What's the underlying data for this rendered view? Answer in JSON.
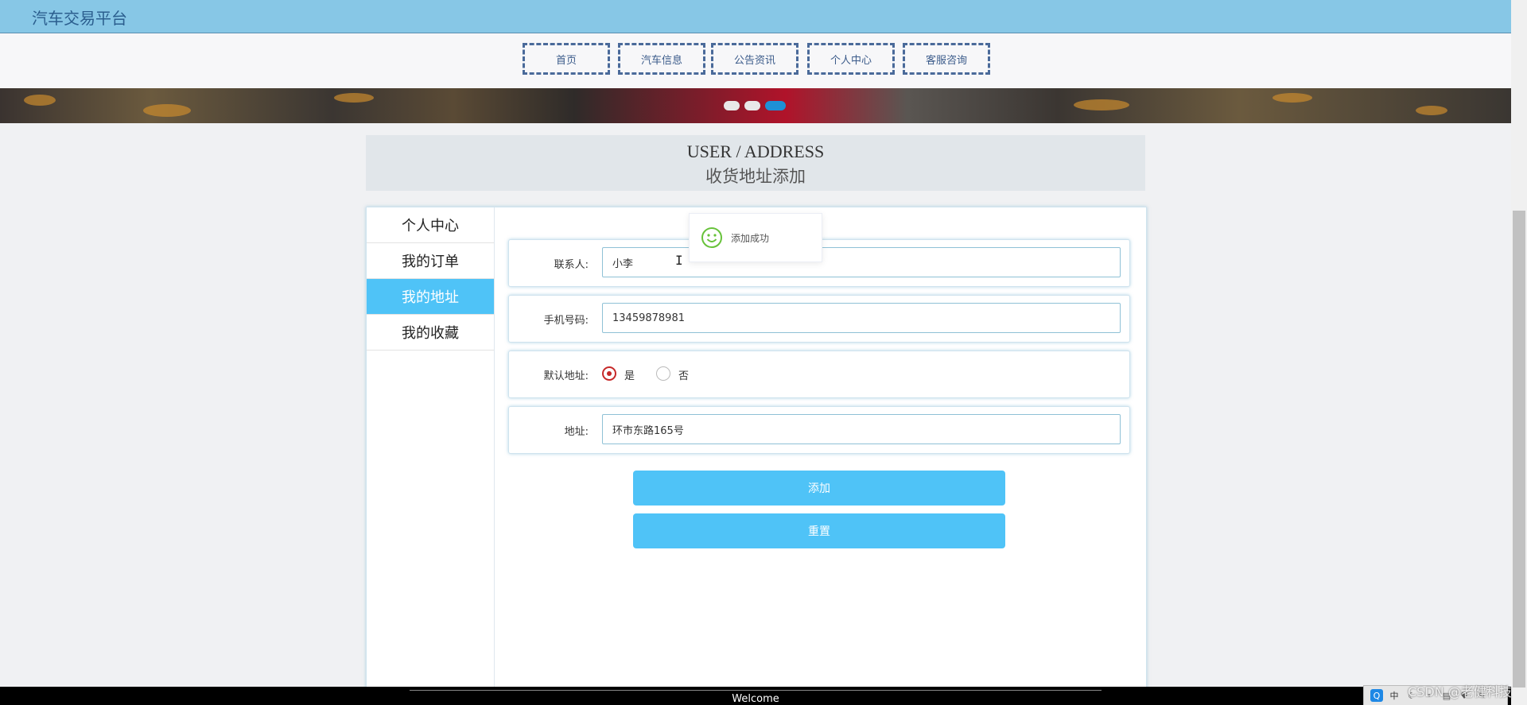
{
  "app": {
    "title": "汽车交易平台"
  },
  "nav": {
    "items": [
      {
        "label": "首页"
      },
      {
        "label": "汽车信息"
      },
      {
        "label": "公告资讯"
      },
      {
        "label": "个人中心"
      },
      {
        "label": "客服咨询"
      }
    ]
  },
  "carousel": {
    "dot_count": 3,
    "active_index": 2
  },
  "header": {
    "title_en": "USER / ADDRESS",
    "title_cn": "收货地址添加"
  },
  "sidebar": {
    "items": [
      {
        "label": "个人中心",
        "active": false
      },
      {
        "label": "我的订单",
        "active": false
      },
      {
        "label": "我的地址",
        "active": true
      },
      {
        "label": "我的收藏",
        "active": false
      }
    ]
  },
  "form": {
    "contact_label": "联系人:",
    "contact_value": "小李",
    "phone_label": "手机号码:",
    "phone_value": "13459878981",
    "default_label": "默认地址:",
    "default_yes": "是",
    "default_no": "否",
    "default_selected": "是",
    "address_label": "地址:",
    "address_value": "环市东路165号",
    "submit_label": "添加",
    "reset_label": "重置"
  },
  "toast": {
    "message": "添加成功",
    "icon": "smile-icon"
  },
  "footer": {
    "text": "Welcome"
  },
  "watermark": {
    "text": "CSDN @老健科技"
  },
  "colors": {
    "topbar": "#87c7e6",
    "accent": "#4fc3f7",
    "nav_border": "#4a6a9a",
    "radio_checked": "#c62828",
    "toast_icon": "#67c23a"
  }
}
